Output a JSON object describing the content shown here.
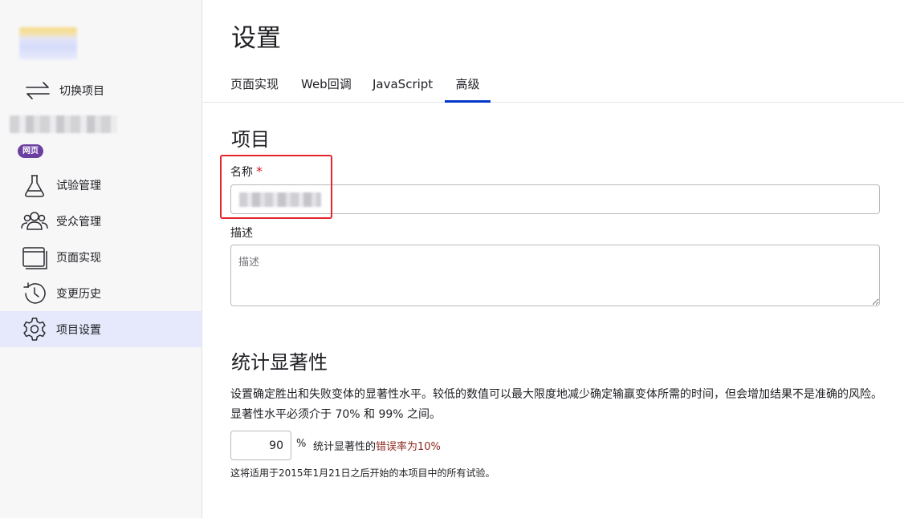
{
  "sidebar": {
    "switch_label": "切换项目",
    "badge": "网页",
    "items": [
      {
        "label": "试验管理",
        "icon": "flask-icon"
      },
      {
        "label": "受众管理",
        "icon": "users-icon"
      },
      {
        "label": "页面实现",
        "icon": "windows-icon"
      },
      {
        "label": "变更历史",
        "icon": "history-icon"
      },
      {
        "label": "项目设置",
        "icon": "gear-icon",
        "active": true
      }
    ]
  },
  "header": {
    "title": "设置"
  },
  "tabs": [
    {
      "label": "页面实现"
    },
    {
      "label": "Web回调"
    },
    {
      "label": "JavaScript"
    },
    {
      "label": "高级",
      "active": true
    }
  ],
  "project_section": {
    "title": "项目",
    "name_label": "名称",
    "required_mark": "*",
    "desc_label": "描述",
    "desc_placeholder": "描述"
  },
  "significance": {
    "title": "统计显著性",
    "description": "设置确定胜出和失败变体的显著性水平。较低的数值可以最大限度地减少确定输赢变体所需的时间，但会增加结果不是准确的风险。显著性水平必须介于 70% 和 99% 之间。",
    "value": "90",
    "percent_sign": "%",
    "hint_prefix": "统计显著性的",
    "hint_error": "错误率为10%",
    "note": "这将适用于2015年1月21日之后开始的本项目中的所有试验。"
  },
  "colors": {
    "accent": "#0037c7",
    "active_bg": "#e6e9fb",
    "badge": "#6b3fa0",
    "required": "#c8202a",
    "highlight": "#e2262b"
  }
}
